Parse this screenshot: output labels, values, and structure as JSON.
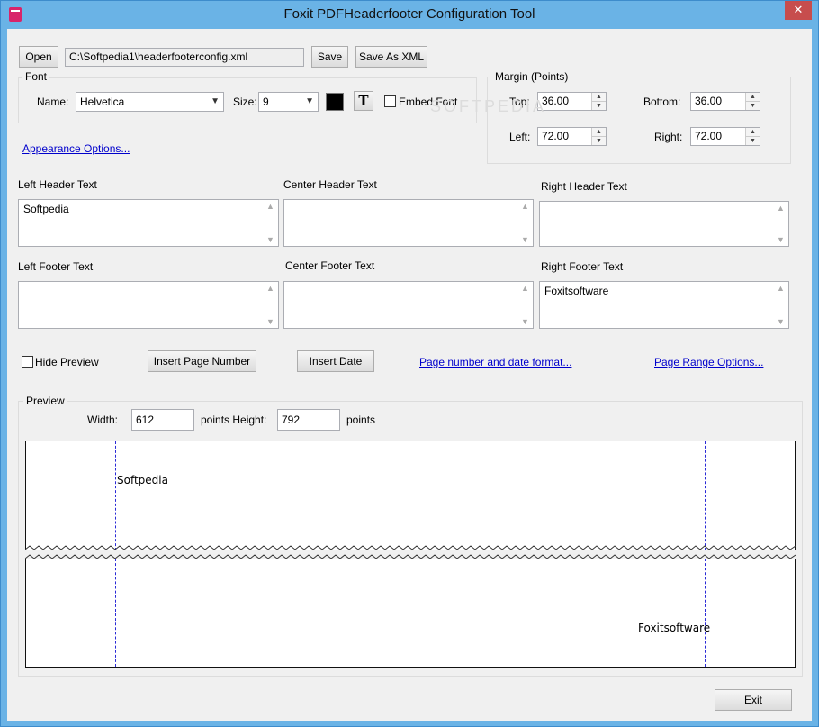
{
  "window": {
    "title": "Foxit PDFHeaderfooter Configuration Tool",
    "close_glyph": "✕"
  },
  "file": {
    "open_label": "Open",
    "path": "C:\\Softpedia1\\headerfooterconfig.xml",
    "save_label": "Save",
    "save_xml_label": "Save As XML"
  },
  "font": {
    "group_label": "Font",
    "name_label": "Name:",
    "name_value": "Helvetica",
    "size_label": "Size:",
    "size_value": "9",
    "color": "#000000",
    "text_style_glyph": "T",
    "embed_label": "Embed Font"
  },
  "margin": {
    "group_label": "Margin (Points)",
    "top_label": "Top:",
    "top_value": "36.00",
    "bottom_label": "Bottom:",
    "bottom_value": "36.00",
    "left_label": "Left:",
    "left_value": "72.00",
    "right_label": "Right:",
    "right_value": "72.00"
  },
  "appearance_link": "Appearance Options...",
  "header": {
    "left_label": "Left Header Text",
    "left_value": "Softpedia",
    "center_label": "Center Header Text",
    "center_value": "",
    "right_label": "Right Header Text",
    "right_value": ""
  },
  "footer": {
    "left_label": "Left Footer Text",
    "left_value": "",
    "center_label": "Center Footer Text",
    "center_value": "",
    "right_label": "Right Footer Text",
    "right_value": "Foxitsoftware"
  },
  "controls": {
    "hide_preview_label": "Hide Preview",
    "insert_page_number_label": "Insert Page Number",
    "insert_date_label": "Insert Date",
    "page_format_link": "Page number and date format...",
    "page_range_link": "Page Range Options..."
  },
  "preview": {
    "group_label": "Preview",
    "width_label": "Width:",
    "width_value": "612",
    "height_label": "points Height:",
    "height_value": "792",
    "points_label": "points",
    "header_text": "Softpedia",
    "footer_text": "Foxitsoftware"
  },
  "exit_label": "Exit",
  "watermark": "SOFTPEDIA",
  "colors": {
    "titlebar": "#6ab3e6",
    "close_button": "#c74d4d",
    "guide_lines": "#2a2ad6",
    "link": "#0000cc"
  }
}
